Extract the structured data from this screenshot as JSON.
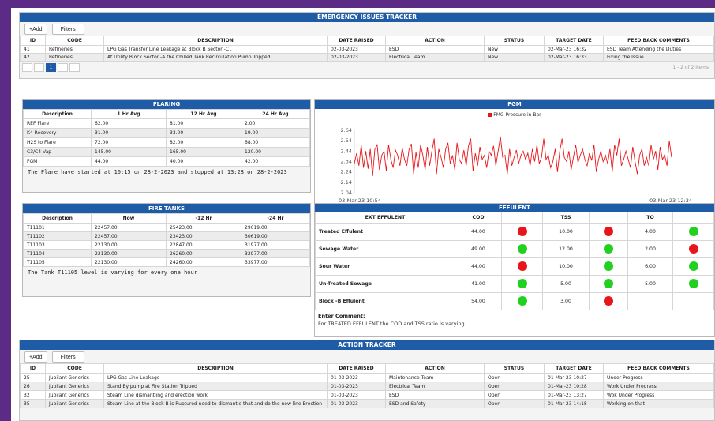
{
  "toolbar": {
    "add_label": "Add",
    "filters_label": "Filters",
    "add_icon": "plus-icon"
  },
  "emergency": {
    "title": "EMERGENCY ISSUES TRACKER",
    "columns": [
      "ID",
      "CODE",
      "DESCRIPTION",
      "DATE RAISED",
      "ACTION",
      "STATUS",
      "TARGET DATE",
      "FEED BACK COMMENTS"
    ],
    "rows": [
      [
        "41",
        "Refineries",
        "LPG Gas Transfer Line Leakage at Block B Sector -C .",
        "02-03-2023",
        "ESD",
        "New",
        "02-Mar-23 16:32",
        "ESD Team Attending the Duties"
      ],
      [
        "42",
        "Refineries",
        "At Utility Block Sector -A the Chilled Tank Recirculation Pump Tripped",
        "02-03-2023",
        "Electrical Team",
        "New",
        "02-Mar-23 16:33",
        "Fixing the Issue"
      ]
    ],
    "pager": {
      "current": "1",
      "summary": "1 - 2 of 2 items"
    }
  },
  "flaring": {
    "title": "FLARING",
    "columns": [
      "Description",
      "1 Hr Avg",
      "12 Hr Avg",
      "24 Hr Avg"
    ],
    "rows": [
      [
        "REF Flare",
        "62.00",
        "81.00",
        "2.00"
      ],
      [
        "K4 Recovery",
        "31.00",
        "33.00",
        "19.00"
      ],
      [
        "H2S to Flare",
        "72.00",
        "82.00",
        "68.00"
      ],
      [
        "C3/C4 Vap",
        "145.00",
        "165.00",
        "120.00"
      ],
      [
        "FGM",
        "44.00",
        "40.00",
        "42.00"
      ]
    ],
    "note": "The Flare have started at 10:15 on 28-2-2023 and stopped at 13:28 on 28-2-2023"
  },
  "fgm": {
    "title": "FGM",
    "chart_data": {
      "type": "line",
      "series": [
        {
          "name": "FMG Pressure in Bar",
          "color": "#e8161b",
          "values": [
            2.32,
            2.42,
            2.3,
            2.5,
            2.28,
            2.44,
            2.27,
            2.46,
            2.2,
            2.46,
            2.5,
            2.26,
            2.4,
            2.44,
            2.25,
            2.5,
            2.36,
            2.28,
            2.45,
            2.4,
            2.3,
            2.47,
            2.36,
            2.3,
            2.46,
            2.51,
            2.22,
            2.43,
            2.28,
            2.5,
            2.4,
            2.26,
            2.48,
            2.3,
            2.44,
            2.56,
            2.22,
            2.46,
            2.38,
            2.28,
            2.46,
            2.52,
            2.32,
            2.4,
            2.26,
            2.52,
            2.36,
            2.32,
            2.45,
            2.3,
            2.49,
            2.56,
            2.25,
            2.42,
            2.3,
            2.48,
            2.36,
            2.4,
            2.28,
            2.44,
            2.4,
            2.49,
            2.3,
            2.44,
            2.58,
            2.38,
            2.4,
            2.22,
            2.46,
            2.3,
            2.38,
            2.45,
            2.32,
            2.4,
            2.44,
            2.36,
            2.42,
            2.3,
            2.46,
            2.34,
            2.5,
            2.32,
            2.38,
            2.56,
            2.36,
            2.4,
            2.28,
            2.34,
            2.46,
            2.24,
            2.44,
            2.56,
            2.38,
            2.34,
            2.44,
            2.26,
            2.38,
            2.5,
            2.33,
            2.4,
            2.46,
            2.36,
            2.3,
            2.42,
            2.35,
            2.5,
            2.24,
            2.36,
            2.44,
            2.34,
            2.4,
            2.32,
            2.46,
            2.24,
            2.5,
            2.4,
            2.56,
            2.3,
            2.36,
            2.44,
            2.36,
            2.28,
            2.48,
            2.34,
            2.22,
            2.4,
            2.46,
            2.3,
            2.38,
            2.3,
            2.5,
            2.36,
            2.44,
            2.26,
            2.48,
            2.36,
            2.4,
            2.3,
            2.54,
            2.38
          ]
        }
      ],
      "yticks": [
        "2.64",
        "2.54",
        "2.44",
        "2.34",
        "2.24",
        "2.14",
        "2.04"
      ],
      "ylim": [
        2.04,
        2.64
      ],
      "x_start_label": "03-Mar-23 10:54",
      "x_end_label": "03-Mar-23 12:34",
      "grid": false,
      "legend": "top-center"
    }
  },
  "firetanks": {
    "title": "FIRE TANKS",
    "columns": [
      "Description",
      "Now",
      "-12 Hr",
      "-24 Hr"
    ],
    "rows": [
      [
        "T11101",
        "22457.00",
        "25423.00",
        "29619.00"
      ],
      [
        "T11102",
        "22457.00",
        "23423.00",
        "30619.00"
      ],
      [
        "T11103",
        "22130.00",
        "22847.00",
        "31977.00"
      ],
      [
        "T11104",
        "22130.00",
        "26260.00",
        "32977.00"
      ],
      [
        "T11105",
        "22130.00",
        "24260.00",
        "33977.00"
      ]
    ],
    "note": "The Tank T11105 level is varying for every one hour"
  },
  "effluent": {
    "title": "EFFULENT",
    "columns": [
      "EXT EFFULENT",
      "COD",
      "TSS",
      "TO"
    ],
    "status_colors": {
      "red": "#e8161b",
      "green": "#22d11f"
    },
    "rows": [
      {
        "name": "Treated Effulent",
        "cod": "44.00",
        "cod_status": "red",
        "tss": "10.00",
        "tss_status": "red",
        "to": "4.00",
        "to_status": "green"
      },
      {
        "name": "Sewage Water",
        "cod": "49.00",
        "cod_status": "green",
        "tss": "12.00",
        "tss_status": "green",
        "to": "2.00",
        "to_status": "red"
      },
      {
        "name": "Sour Water",
        "cod": "44.00",
        "cod_status": "red",
        "tss": "10.00",
        "tss_status": "green",
        "to": "6.00",
        "to_status": "green"
      },
      {
        "name": "Un-Treated Sewage",
        "cod": "41.00",
        "cod_status": "green",
        "tss": "5.00",
        "tss_status": "green",
        "to": "5.00",
        "to_status": "green"
      },
      {
        "name": "Block -B Effulent",
        "cod": "54.00",
        "cod_status": "green",
        "tss": "3.00",
        "tss_status": "red",
        "to": "",
        "to_status": ""
      }
    ],
    "comment_label": "Enter Comment:",
    "comment": "For TREATED EFFULENT the COD and TSS ratio is varying."
  },
  "action": {
    "title": "ACTION TRACKER",
    "columns": [
      "ID",
      "CODE",
      "DESCRIPTION",
      "DATE RAISED",
      "ACTION",
      "STATUS",
      "TARGET DATE",
      "FEED BACK COMMENTS"
    ],
    "rows": [
      [
        "25",
        "Jubilant Generics",
        "LPG Gas Line Leakage",
        "01-03-2023",
        "Maintenance Team",
        "Open",
        "01-Mar-23 10:27",
        "Under Progress"
      ],
      [
        "26",
        "Jubilant Generics",
        "Stand By pump at Fire Station Tripped",
        "01-03-2023",
        "Electrical Team",
        "Open",
        "01-Mar-23 10:28",
        "Work Under Progress"
      ],
      [
        "32",
        "Jubilant Generics",
        "Steam Line dismantling and erection work",
        "01-03-2023",
        "ESD",
        "Open",
        "01-Mar-23 13:27",
        "Wok Under Progress"
      ],
      [
        "35",
        "Jubilant Generics",
        "Steam Line at the Block B is Ruptured need to dismantle that and do the new line Erection",
        "01-03-2023",
        "ESD and Safety",
        "Open",
        "01-Mar-23 14:18",
        "Working on that"
      ]
    ]
  }
}
